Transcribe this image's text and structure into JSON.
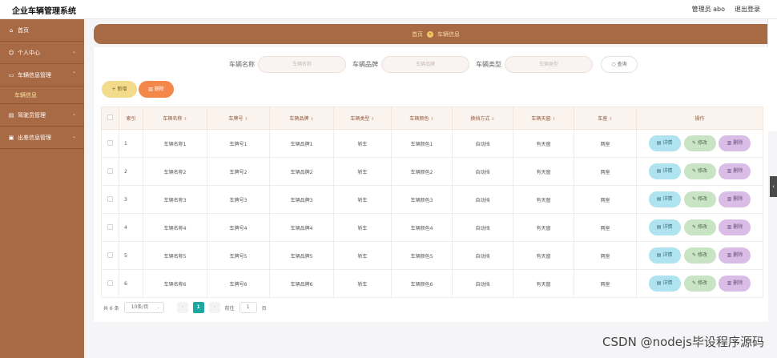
{
  "app_title": "企业车辆管理系统",
  "header": {
    "admin": "管理员 abo",
    "logout": "退出登录"
  },
  "sidebar": {
    "items": [
      {
        "icon": "home-icon",
        "label": "首页"
      },
      {
        "icon": "user-icon",
        "label": "个人中心"
      },
      {
        "icon": "car-icon",
        "label": "车辆信息管理",
        "sub": "车辆信息"
      },
      {
        "icon": "driver-icon",
        "label": "驾驶员管理"
      },
      {
        "icon": "trip-icon",
        "label": "出差信息管理"
      }
    ]
  },
  "breadcrumb": {
    "home": "首页",
    "current": "车辆信息"
  },
  "search": {
    "name_label": "车辆名称",
    "name_placeholder": "车辆名称",
    "brand_label": "车辆品牌",
    "brand_placeholder": "车辆品牌",
    "type_label": "车辆类型",
    "type_placeholder": "车辆类型",
    "button": "查询"
  },
  "toolbar": {
    "add": "新增",
    "delete": "删除"
  },
  "table": {
    "headers": [
      "索引",
      "车辆名称",
      "车牌号",
      "车辆品牌",
      "车辆类型",
      "车辆颜色",
      "换挡方式",
      "车辆天窗",
      "车座",
      "操作"
    ],
    "rows": [
      [
        "1",
        "车辆名称1",
        "车牌号1",
        "车辆品牌1",
        "轿车",
        "车辆颜色1",
        "自动挡",
        "有天窗",
        "两座"
      ],
      [
        "2",
        "车辆名称2",
        "车牌号2",
        "车辆品牌2",
        "轿车",
        "车辆颜色2",
        "自动挡",
        "有天窗",
        "两座"
      ],
      [
        "3",
        "车辆名称3",
        "车牌号3",
        "车辆品牌3",
        "轿车",
        "车辆颜色3",
        "自动挡",
        "有天窗",
        "两座"
      ],
      [
        "4",
        "车辆名称4",
        "车牌号4",
        "车辆品牌4",
        "轿车",
        "车辆颜色4",
        "自动挡",
        "有天窗",
        "两座"
      ],
      [
        "5",
        "车辆名称5",
        "车牌号5",
        "车辆品牌5",
        "轿车",
        "车辆颜色5",
        "自动挡",
        "有天窗",
        "两座"
      ],
      [
        "6",
        "车辆名称6",
        "车牌号6",
        "车辆品牌6",
        "轿车",
        "车辆颜色6",
        "自动挡",
        "有天窗",
        "两座"
      ]
    ],
    "actions": {
      "detail": "详情",
      "edit": "修改",
      "delete": "删除"
    }
  },
  "pager": {
    "total": "共 6 条",
    "page_size": "10条/页",
    "current": "1",
    "goto_label": "前往",
    "goto_value": "1",
    "page_suffix": "页"
  },
  "watermark": "CSDN @nodejs毕设程序源码",
  "colors": {
    "sidebar": "#a86a45",
    "accent": "#1aa8a0",
    "add": "#f2dc8c",
    "delete": "#f4884a"
  }
}
